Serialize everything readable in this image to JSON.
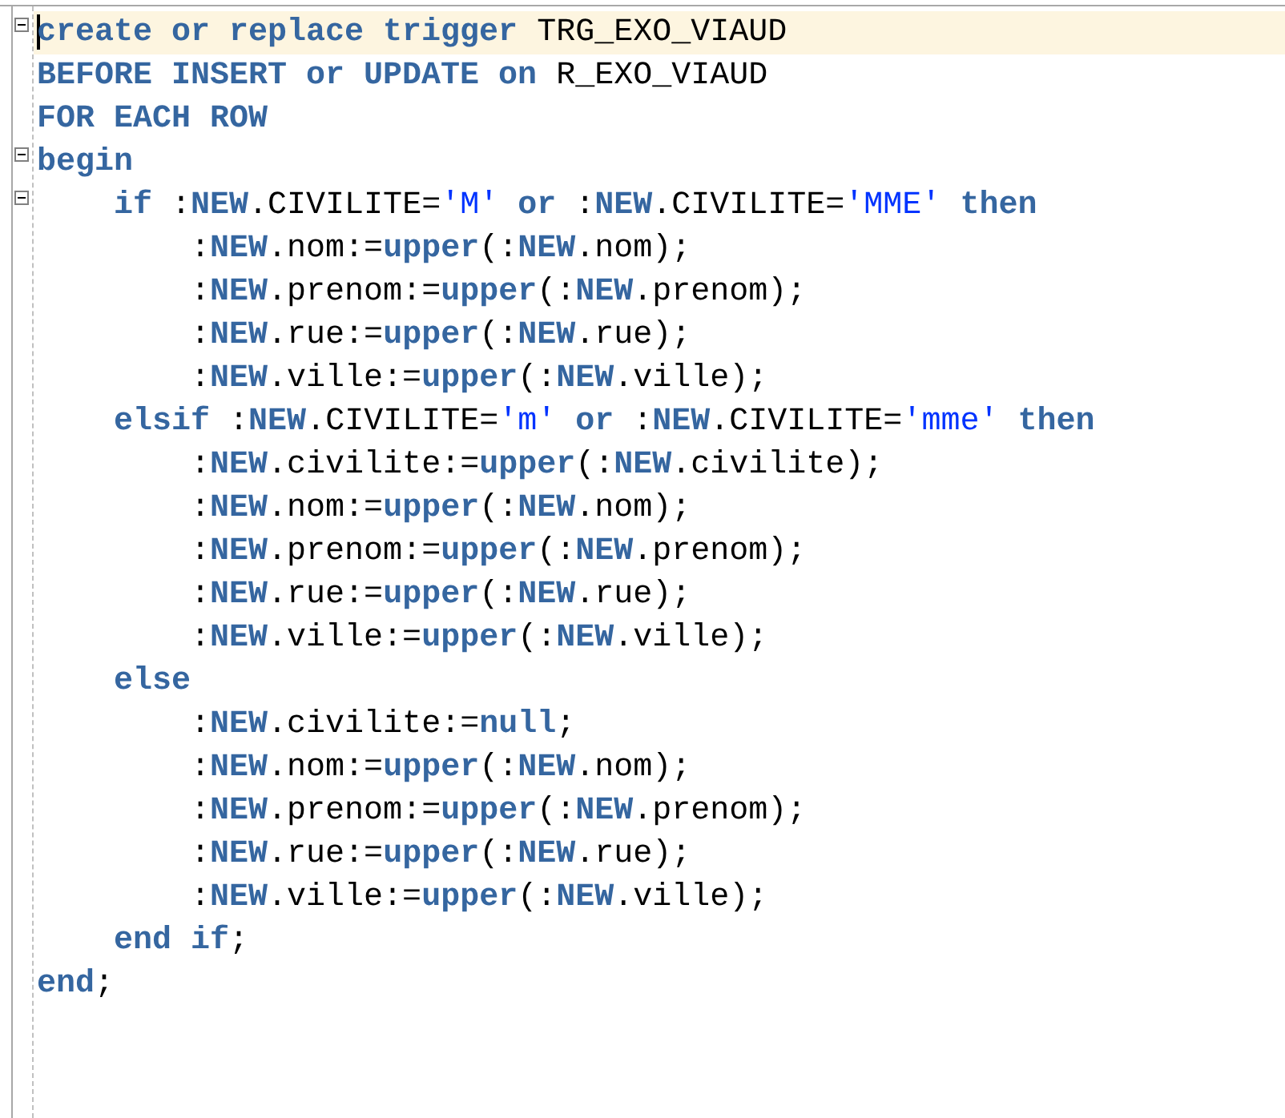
{
  "editor": {
    "lines": [
      {
        "foldable": true,
        "current": true,
        "tokens": [
          {
            "kind": "kw",
            "text": "create or replace trigger"
          },
          {
            "kind": "plain",
            "text": " TRG_EXO_VIAUD"
          }
        ]
      },
      {
        "foldable": false,
        "current": false,
        "tokens": [
          {
            "kind": "kw",
            "text": "BEFORE INSERT or UPDATE on"
          },
          {
            "kind": "plain",
            "text": " R_EXO_VIAUD"
          }
        ]
      },
      {
        "foldable": false,
        "current": false,
        "tokens": [
          {
            "kind": "kw",
            "text": "FOR EACH ROW"
          }
        ]
      },
      {
        "foldable": true,
        "current": false,
        "tokens": [
          {
            "kind": "kw",
            "text": "begin"
          }
        ]
      },
      {
        "foldable": true,
        "current": false,
        "tokens": [
          {
            "kind": "kw",
            "text": "    if"
          },
          {
            "kind": "plain",
            "text": " :"
          },
          {
            "kind": "kw",
            "text": "NEW"
          },
          {
            "kind": "plain",
            "text": ".CIVILITE="
          },
          {
            "kind": "str",
            "text": "'M'"
          },
          {
            "kind": "kw",
            "text": " or"
          },
          {
            "kind": "plain",
            "text": " :"
          },
          {
            "kind": "kw",
            "text": "NEW"
          },
          {
            "kind": "plain",
            "text": ".CIVILITE="
          },
          {
            "kind": "str",
            "text": "'MME'"
          },
          {
            "kind": "kw",
            "text": " then"
          }
        ]
      },
      {
        "foldable": false,
        "current": false,
        "tokens": [
          {
            "kind": "plain",
            "text": "        :"
          },
          {
            "kind": "kw",
            "text": "NEW"
          },
          {
            "kind": "plain",
            "text": ".nom:="
          },
          {
            "kind": "kw",
            "text": "upper"
          },
          {
            "kind": "plain",
            "text": "(:"
          },
          {
            "kind": "kw",
            "text": "NEW"
          },
          {
            "kind": "plain",
            "text": ".nom);"
          }
        ]
      },
      {
        "foldable": false,
        "current": false,
        "tokens": [
          {
            "kind": "plain",
            "text": "        :"
          },
          {
            "kind": "kw",
            "text": "NEW"
          },
          {
            "kind": "plain",
            "text": ".prenom:="
          },
          {
            "kind": "kw",
            "text": "upper"
          },
          {
            "kind": "plain",
            "text": "(:"
          },
          {
            "kind": "kw",
            "text": "NEW"
          },
          {
            "kind": "plain",
            "text": ".prenom);"
          }
        ]
      },
      {
        "foldable": false,
        "current": false,
        "tokens": [
          {
            "kind": "plain",
            "text": "        :"
          },
          {
            "kind": "kw",
            "text": "NEW"
          },
          {
            "kind": "plain",
            "text": ".rue:="
          },
          {
            "kind": "kw",
            "text": "upper"
          },
          {
            "kind": "plain",
            "text": "(:"
          },
          {
            "kind": "kw",
            "text": "NEW"
          },
          {
            "kind": "plain",
            "text": ".rue);"
          }
        ]
      },
      {
        "foldable": false,
        "current": false,
        "tokens": [
          {
            "kind": "plain",
            "text": "        :"
          },
          {
            "kind": "kw",
            "text": "NEW"
          },
          {
            "kind": "plain",
            "text": ".ville:="
          },
          {
            "kind": "kw",
            "text": "upper"
          },
          {
            "kind": "plain",
            "text": "(:"
          },
          {
            "kind": "kw",
            "text": "NEW"
          },
          {
            "kind": "plain",
            "text": ".ville);"
          }
        ]
      },
      {
        "foldable": false,
        "current": false,
        "tokens": [
          {
            "kind": "kw",
            "text": "    elsif"
          },
          {
            "kind": "plain",
            "text": " :"
          },
          {
            "kind": "kw",
            "text": "NEW"
          },
          {
            "kind": "plain",
            "text": ".CIVILITE="
          },
          {
            "kind": "str",
            "text": "'m'"
          },
          {
            "kind": "kw",
            "text": " or"
          },
          {
            "kind": "plain",
            "text": " :"
          },
          {
            "kind": "kw",
            "text": "NEW"
          },
          {
            "kind": "plain",
            "text": ".CIVILITE="
          },
          {
            "kind": "str",
            "text": "'mme'"
          },
          {
            "kind": "kw",
            "text": " then"
          }
        ]
      },
      {
        "foldable": false,
        "current": false,
        "tokens": [
          {
            "kind": "plain",
            "text": "        :"
          },
          {
            "kind": "kw",
            "text": "NEW"
          },
          {
            "kind": "plain",
            "text": ".civilite:="
          },
          {
            "kind": "kw",
            "text": "upper"
          },
          {
            "kind": "plain",
            "text": "(:"
          },
          {
            "kind": "kw",
            "text": "NEW"
          },
          {
            "kind": "plain",
            "text": ".civilite);"
          }
        ]
      },
      {
        "foldable": false,
        "current": false,
        "tokens": [
          {
            "kind": "plain",
            "text": "        :"
          },
          {
            "kind": "kw",
            "text": "NEW"
          },
          {
            "kind": "plain",
            "text": ".nom:="
          },
          {
            "kind": "kw",
            "text": "upper"
          },
          {
            "kind": "plain",
            "text": "(:"
          },
          {
            "kind": "kw",
            "text": "NEW"
          },
          {
            "kind": "plain",
            "text": ".nom);"
          }
        ]
      },
      {
        "foldable": false,
        "current": false,
        "tokens": [
          {
            "kind": "plain",
            "text": "        :"
          },
          {
            "kind": "kw",
            "text": "NEW"
          },
          {
            "kind": "plain",
            "text": ".prenom:="
          },
          {
            "kind": "kw",
            "text": "upper"
          },
          {
            "kind": "plain",
            "text": "(:"
          },
          {
            "kind": "kw",
            "text": "NEW"
          },
          {
            "kind": "plain",
            "text": ".prenom);"
          }
        ]
      },
      {
        "foldable": false,
        "current": false,
        "tokens": [
          {
            "kind": "plain",
            "text": "        :"
          },
          {
            "kind": "kw",
            "text": "NEW"
          },
          {
            "kind": "plain",
            "text": ".rue:="
          },
          {
            "kind": "kw",
            "text": "upper"
          },
          {
            "kind": "plain",
            "text": "(:"
          },
          {
            "kind": "kw",
            "text": "NEW"
          },
          {
            "kind": "plain",
            "text": ".rue);"
          }
        ]
      },
      {
        "foldable": false,
        "current": false,
        "tokens": [
          {
            "kind": "plain",
            "text": "        :"
          },
          {
            "kind": "kw",
            "text": "NEW"
          },
          {
            "kind": "plain",
            "text": ".ville:="
          },
          {
            "kind": "kw",
            "text": "upper"
          },
          {
            "kind": "plain",
            "text": "(:"
          },
          {
            "kind": "kw",
            "text": "NEW"
          },
          {
            "kind": "plain",
            "text": ".ville);"
          }
        ]
      },
      {
        "foldable": false,
        "current": false,
        "tokens": [
          {
            "kind": "kw",
            "text": "    else"
          }
        ]
      },
      {
        "foldable": false,
        "current": false,
        "tokens": [
          {
            "kind": "plain",
            "text": "        :"
          },
          {
            "kind": "kw",
            "text": "NEW"
          },
          {
            "kind": "plain",
            "text": ".civilite:="
          },
          {
            "kind": "kw",
            "text": "null"
          },
          {
            "kind": "plain",
            "text": ";"
          }
        ]
      },
      {
        "foldable": false,
        "current": false,
        "tokens": [
          {
            "kind": "plain",
            "text": "        :"
          },
          {
            "kind": "kw",
            "text": "NEW"
          },
          {
            "kind": "plain",
            "text": ".nom:="
          },
          {
            "kind": "kw",
            "text": "upper"
          },
          {
            "kind": "plain",
            "text": "(:"
          },
          {
            "kind": "kw",
            "text": "NEW"
          },
          {
            "kind": "plain",
            "text": ".nom);"
          }
        ]
      },
      {
        "foldable": false,
        "current": false,
        "tokens": [
          {
            "kind": "plain",
            "text": "        :"
          },
          {
            "kind": "kw",
            "text": "NEW"
          },
          {
            "kind": "plain",
            "text": ".prenom:="
          },
          {
            "kind": "kw",
            "text": "upper"
          },
          {
            "kind": "plain",
            "text": "(:"
          },
          {
            "kind": "kw",
            "text": "NEW"
          },
          {
            "kind": "plain",
            "text": ".prenom);"
          }
        ]
      },
      {
        "foldable": false,
        "current": false,
        "tokens": [
          {
            "kind": "plain",
            "text": "        :"
          },
          {
            "kind": "kw",
            "text": "NEW"
          },
          {
            "kind": "plain",
            "text": ".rue:="
          },
          {
            "kind": "kw",
            "text": "upper"
          },
          {
            "kind": "plain",
            "text": "(:"
          },
          {
            "kind": "kw",
            "text": "NEW"
          },
          {
            "kind": "plain",
            "text": ".rue);"
          }
        ]
      },
      {
        "foldable": false,
        "current": false,
        "tokens": [
          {
            "kind": "plain",
            "text": "        :"
          },
          {
            "kind": "kw",
            "text": "NEW"
          },
          {
            "kind": "plain",
            "text": ".ville:="
          },
          {
            "kind": "kw",
            "text": "upper"
          },
          {
            "kind": "plain",
            "text": "(:"
          },
          {
            "kind": "kw",
            "text": "NEW"
          },
          {
            "kind": "plain",
            "text": ".ville);"
          }
        ]
      },
      {
        "foldable": false,
        "current": false,
        "tokens": [
          {
            "kind": "kw",
            "text": "    end if"
          },
          {
            "kind": "plain",
            "text": ";"
          }
        ]
      },
      {
        "foldable": false,
        "current": false,
        "tokens": [
          {
            "kind": "kw",
            "text": "end"
          },
          {
            "kind": "plain",
            "text": ";"
          }
        ]
      }
    ]
  }
}
